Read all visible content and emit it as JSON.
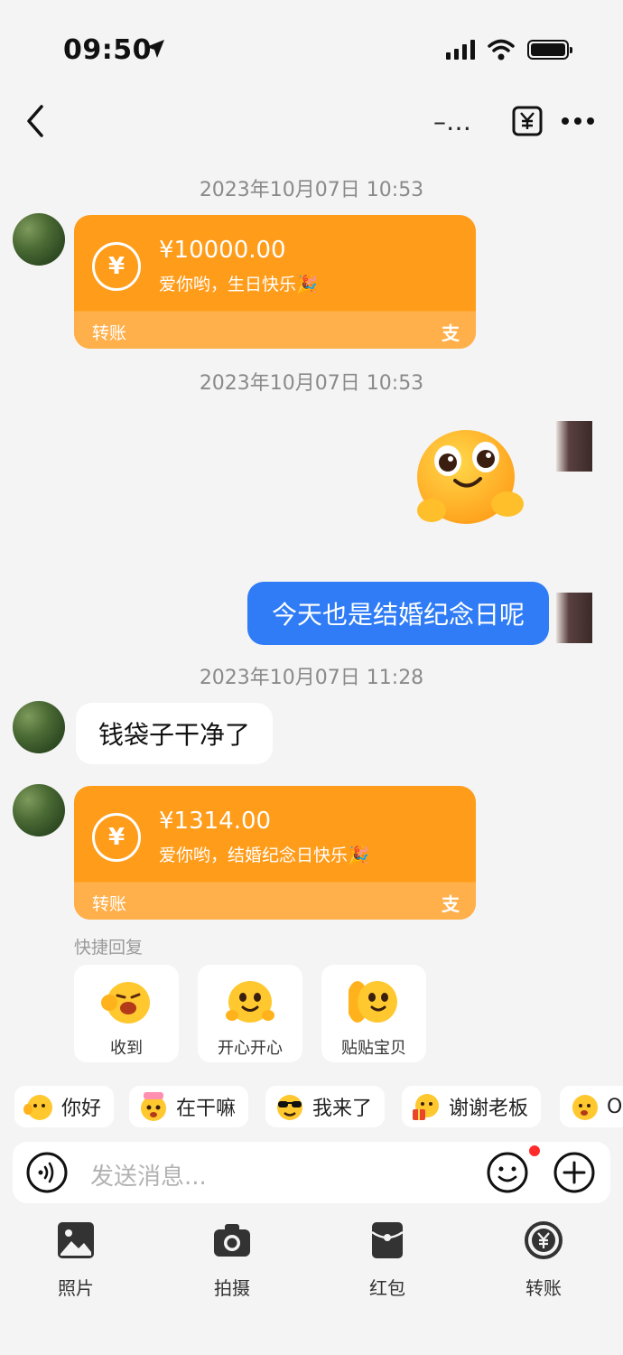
{
  "status": {
    "time": "09:50"
  },
  "nav": {
    "title": "–…"
  },
  "messages": {
    "ts1": "2023年10月07日 10:53",
    "transfer1": {
      "amount": "¥10000.00",
      "memo": "爱你哟，生日快乐🎉",
      "label": "转账",
      "brand_glyph": "支"
    },
    "ts2": "2023年10月07日 10:53",
    "me_text": "今天也是结婚纪念日呢",
    "ts3": "2023年10月07日 11:28",
    "them_text": "钱袋子干净了",
    "transfer2": {
      "amount": "¥1314.00",
      "memo": "爱你哟，结婚纪念日快乐🎉",
      "label": "转账",
      "brand_glyph": "支"
    }
  },
  "quick_reply": {
    "title": "快捷回复",
    "items": [
      {
        "label": "收到"
      },
      {
        "label": "开心开心"
      },
      {
        "label": "贴贴宝贝"
      }
    ]
  },
  "chips": [
    {
      "label": "你好"
    },
    {
      "label": "在干嘛"
    },
    {
      "label": "我来了"
    },
    {
      "label": "谢谢老板"
    },
    {
      "label": "O"
    }
  ],
  "input": {
    "placeholder": "发送消息..."
  },
  "toolbar": [
    {
      "label": "照片"
    },
    {
      "label": "拍摄"
    },
    {
      "label": "红包"
    },
    {
      "label": "转账"
    }
  ],
  "colors": {
    "accent_orange": "#ff9c1a",
    "my_bubble": "#2f7cf6",
    "badge_red": "#ff2a2a"
  }
}
